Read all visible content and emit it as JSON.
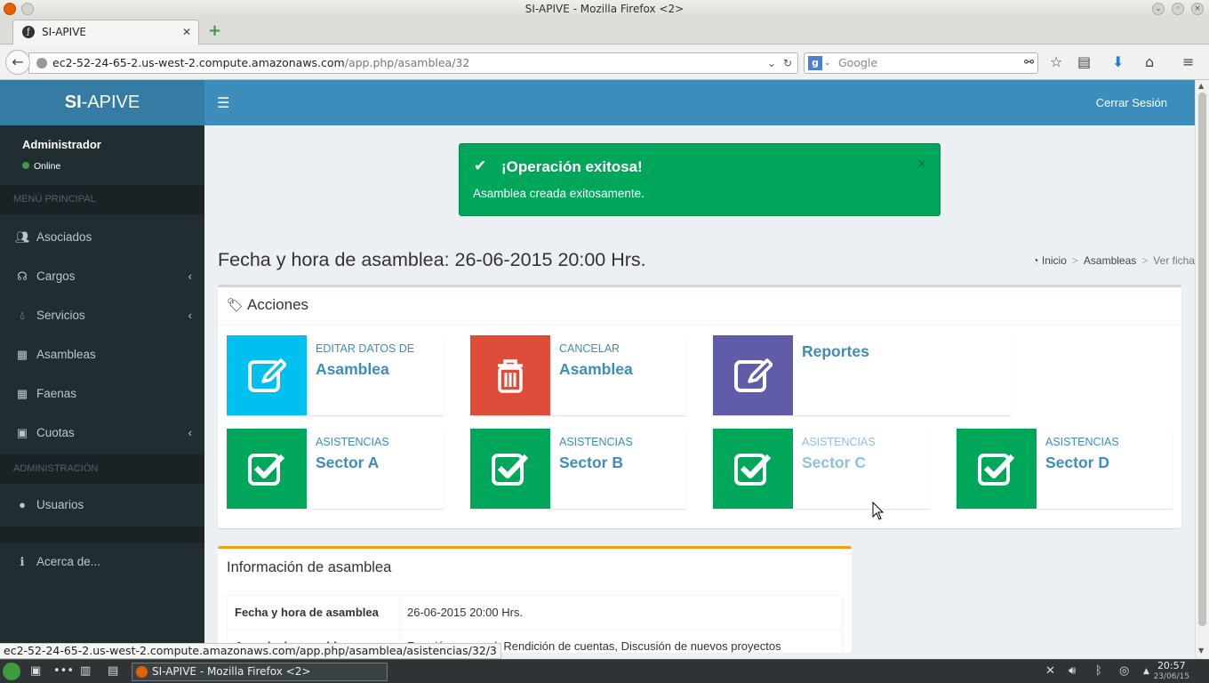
{
  "browser": {
    "window_title": "SI-APIVE - Mozilla Firefox <2>",
    "tab_title": "SI-APIVE",
    "url_host": "ec2-52-24-65-2.us-west-2.compute.amazonaws.com",
    "url_path": "/app.php/asamblea/32",
    "search_placeholder": "Google",
    "status_url": "ec2-52-24-65-2.us-west-2.compute.amazonaws.com/app.php/asamblea/asistencias/32/3"
  },
  "app": {
    "logo_bold": "SI",
    "logo_rest": "-APIVE",
    "logout_label": "Cerrar Sesión"
  },
  "sidebar": {
    "user_name": "Administrador",
    "user_status": "Online",
    "section_main": "MENÚ PRINCIPAL",
    "section_admin": "ADMINISTRACIÓN",
    "items": [
      {
        "label": "Asociados",
        "icon": "users-icon"
      },
      {
        "label": "Cargos",
        "icon": "sitemap-icon"
      },
      {
        "label": "Servicios",
        "icon": "tint-icon"
      },
      {
        "label": "Asambleas",
        "icon": "calendar-icon"
      },
      {
        "label": "Faenas",
        "icon": "calendar-icon"
      },
      {
        "label": "Cuotas",
        "icon": "money-icon"
      },
      {
        "label": "Usuarios",
        "icon": "user-icon"
      },
      {
        "label": "Acerca de...",
        "icon": "info-icon"
      }
    ]
  },
  "alert": {
    "title": "¡Operación exitosa!",
    "message": "Asamblea creada exitosamente."
  },
  "page": {
    "title": "Fecha y hora de asamblea: 26-06-2015 20:00 Hrs.",
    "breadcrumb": [
      "Inicio",
      "Asambleas",
      "Ver ficha"
    ]
  },
  "actions": {
    "header": "Acciones",
    "boxes": [
      {
        "label": "EDITAR DATOS DE",
        "value": "Asamblea",
        "color": "#00c0ef",
        "icon": "edit-icon"
      },
      {
        "label": "CANCELAR",
        "value": "Asamblea",
        "color": "#dd4b39",
        "icon": "trash-icon"
      },
      {
        "label": "",
        "value": "Reportes",
        "color": "#605ca8",
        "icon": "edit-icon"
      },
      {
        "label": "ASISTENCIAS",
        "value": "Sector A",
        "color": "#00a65a",
        "icon": "check-square-icon"
      },
      {
        "label": "ASISTENCIAS",
        "value": "Sector B",
        "color": "#00a65a",
        "icon": "check-square-icon"
      },
      {
        "label": "ASISTENCIAS",
        "value": "Sector C",
        "color": "#00a65a",
        "icon": "check-square-icon"
      },
      {
        "label": "ASISTENCIAS",
        "value": "Sector D",
        "color": "#00a65a",
        "icon": "check-square-icon"
      }
    ]
  },
  "info": {
    "header": "Información de asamblea",
    "rows": [
      {
        "key": "Fecha y hora de asamblea",
        "value": "26-06-2015 20:00 Hrs."
      },
      {
        "key": "Agenda de asamblea",
        "value": "Reunión mensual: Rendición de cuentas, Discusión de nuevos proyectos"
      }
    ]
  },
  "taskbar": {
    "window_label": "SI-APIVE - Mozilla Firefox <2>",
    "time": "20:57",
    "date": "23/06/15"
  }
}
